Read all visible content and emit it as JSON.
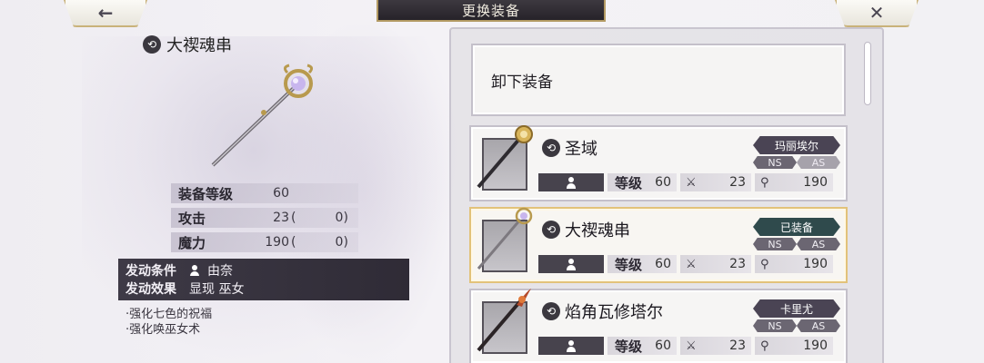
{
  "header": {
    "back_icon": "←",
    "title": "更换装备",
    "close_icon": "✕"
  },
  "detail": {
    "item_name": "大禊魂串",
    "stats": [
      {
        "label": "装备等级",
        "value": "60",
        "bonus": ""
      },
      {
        "label": "攻击",
        "value": "23",
        "bonus": "0"
      },
      {
        "label": "魔力",
        "value": "190",
        "bonus": "0"
      }
    ],
    "condition_label": "发动条件",
    "condition_value": "由奈",
    "effect_label": "发动效果",
    "effect_value": "显现 巫女",
    "effects": [
      "·强化七色的祝福",
      "·强化唤巫女术"
    ]
  },
  "list": {
    "unequip_label": "卸下装备",
    "stat_level_label": "等级",
    "items": [
      {
        "name": "圣域",
        "badge": "玛丽埃尔",
        "ns": "NS",
        "as": "AS",
        "level": "60",
        "attack": "23",
        "magic": "190",
        "equipped": false
      },
      {
        "name": "大禊魂串",
        "badge": "已装备",
        "ns": "NS",
        "as": "AS",
        "level": "60",
        "attack": "23",
        "magic": "190",
        "equipped": true
      },
      {
        "name": "焰角瓦修塔尔",
        "badge": "卡里尤",
        "ns": "NS",
        "as": "AS",
        "level": "60",
        "attack": "23",
        "magic": "190",
        "equipped": false
      }
    ]
  },
  "colors": {
    "accent_gold": "#c9b27a",
    "dark_panel": "#3e3a46",
    "equipped_border": "#e2c27a"
  }
}
